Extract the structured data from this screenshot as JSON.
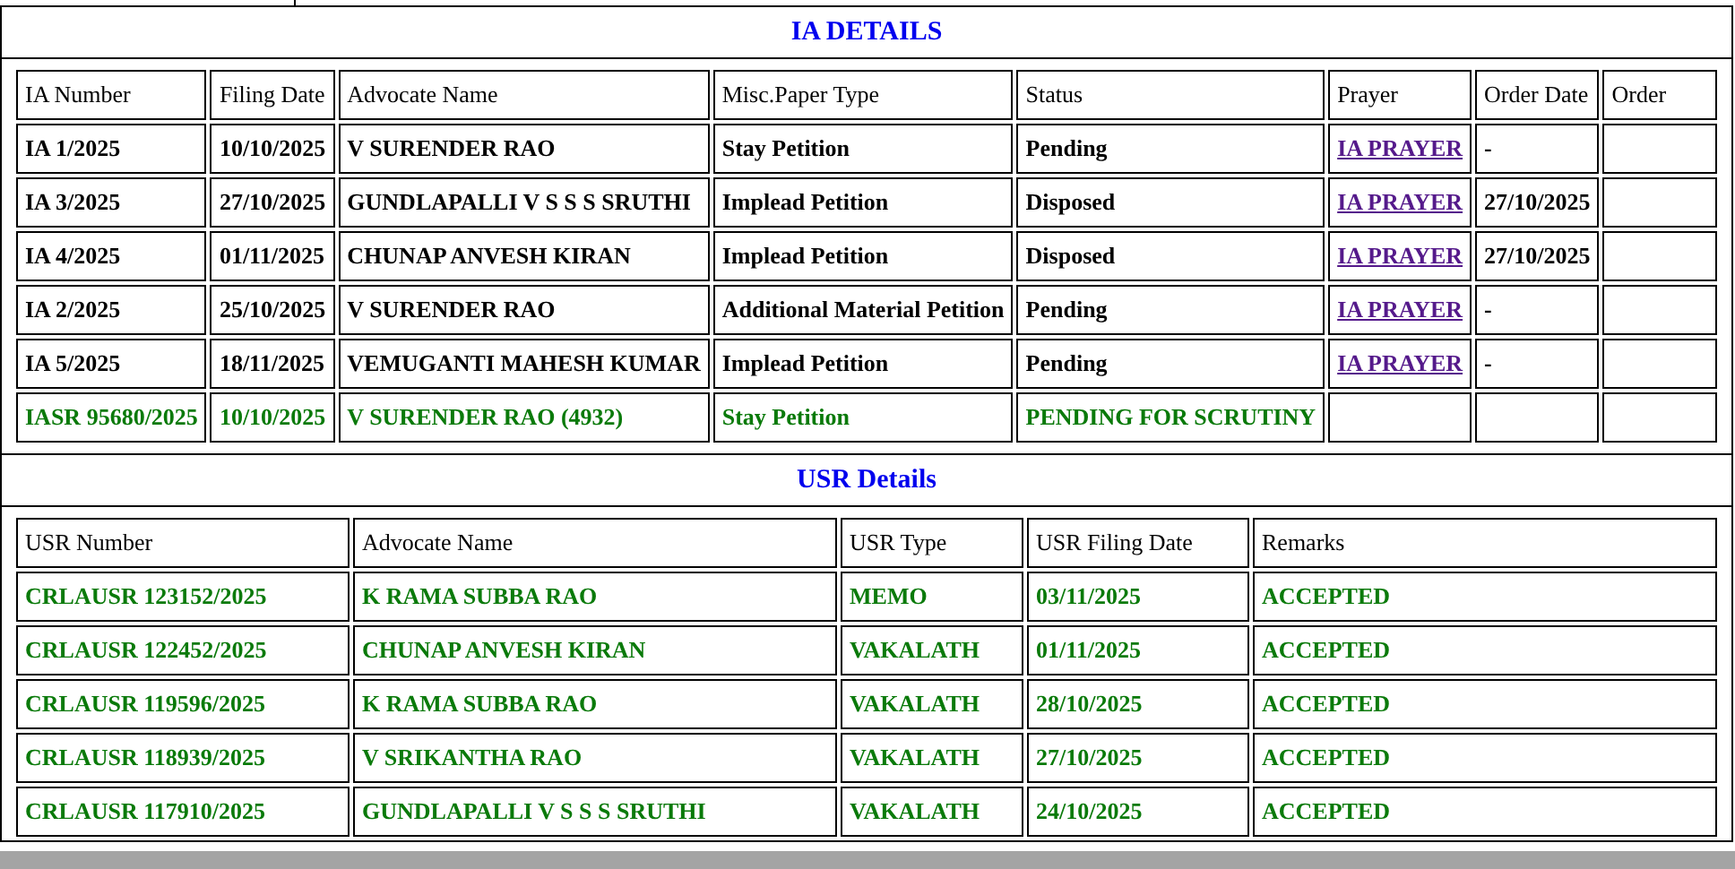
{
  "ia_details": {
    "title": "IA DETAILS",
    "columns": [
      "IA Number",
      "Filing Date",
      "Advocate Name",
      "Misc.Paper Type",
      "Status",
      "Prayer",
      "Order Date",
      "Order"
    ],
    "rows": [
      {
        "kind": "registered",
        "ia_number": "IA 1/2025",
        "filing_date": "10/10/2025",
        "advocate_name": "V SURENDER RAO",
        "misc_paper_type": "Stay Petition",
        "status": "Pending",
        "prayer": "IA PRAYER",
        "order_date": "-"
      },
      {
        "kind": "registered",
        "ia_number": "IA 3/2025",
        "filing_date": "27/10/2025",
        "advocate_name": "GUNDLAPALLI V S S S SRUTHI",
        "misc_paper_type": "Implead Petition",
        "status": "Disposed",
        "prayer": "IA PRAYER",
        "order_date": "27/10/2025"
      },
      {
        "kind": "registered",
        "ia_number": "IA 4/2025",
        "filing_date": "01/11/2025",
        "advocate_name": "CHUNAP ANVESH KIRAN",
        "misc_paper_type": "Implead Petition",
        "status": "Disposed",
        "prayer": "IA PRAYER",
        "order_date": "27/10/2025"
      },
      {
        "kind": "registered",
        "ia_number": "IA 2/2025",
        "filing_date": "25/10/2025",
        "advocate_name": "V SURENDER RAO",
        "misc_paper_type": "Additional Material Petition",
        "status": "Pending",
        "prayer": "IA PRAYER",
        "order_date": "-"
      },
      {
        "kind": "registered",
        "ia_number": "IA 5/2025",
        "filing_date": "18/11/2025",
        "advocate_name": "VEMUGANTI MAHESH KUMAR",
        "misc_paper_type": "Implead Petition",
        "status": "Pending",
        "prayer": "IA PRAYER",
        "order_date": "-"
      },
      {
        "kind": "unregistered",
        "ia_number": "IASR 95680/2025",
        "filing_date": "10/10/2025",
        "advocate_name": "V SURENDER RAO (4932)",
        "misc_paper_type": "Stay Petition",
        "status": "PENDING FOR SCRUTINY"
      }
    ]
  },
  "usr_details": {
    "title": "USR Details",
    "columns": [
      "USR Number",
      "Advocate Name",
      "USR Type",
      "USR Filing Date",
      "Remarks"
    ],
    "rows": [
      {
        "usr_number": "CRLAUSR 123152/2025",
        "advocate_name": "K RAMA SUBBA RAO",
        "usr_type": "MEMO",
        "usr_filing_date": "03/11/2025",
        "remarks": "ACCEPTED"
      },
      {
        "usr_number": "CRLAUSR 122452/2025",
        "advocate_name": "CHUNAP ANVESH KIRAN",
        "usr_type": "VAKALATH",
        "usr_filing_date": "01/11/2025",
        "remarks": "ACCEPTED"
      },
      {
        "usr_number": "CRLAUSR 119596/2025",
        "advocate_name": "K RAMA SUBBA RAO",
        "usr_type": "VAKALATH",
        "usr_filing_date": "28/10/2025",
        "remarks": "ACCEPTED"
      },
      {
        "usr_number": "CRLAUSR 118939/2025",
        "advocate_name": "V SRIKANTHA RAO",
        "usr_type": "VAKALATH",
        "usr_filing_date": "27/10/2025",
        "remarks": "ACCEPTED"
      },
      {
        "usr_number": "CRLAUSR 117910/2025",
        "advocate_name": "GUNDLAPALLI V S S S SRUTHI",
        "usr_type": "VAKALATH",
        "usr_filing_date": "24/10/2025",
        "remarks": "ACCEPTED"
      }
    ]
  }
}
